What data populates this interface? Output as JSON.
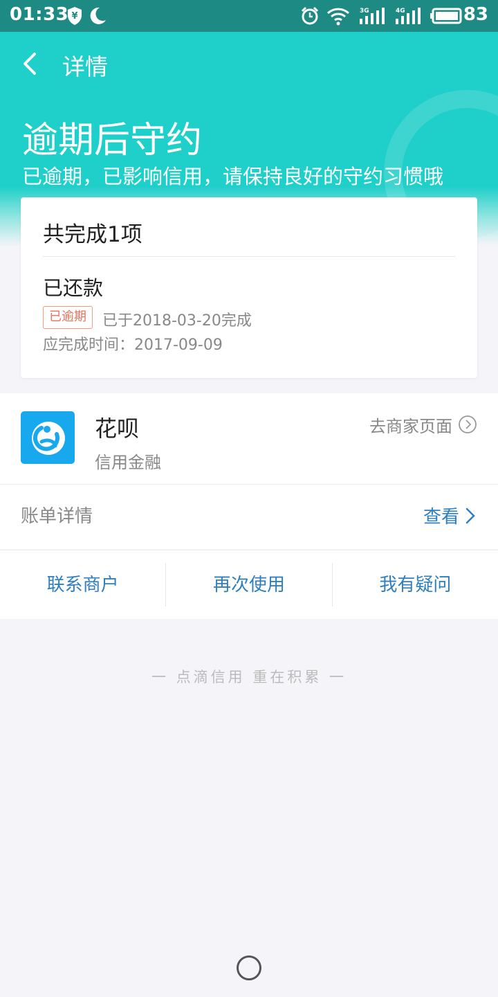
{
  "status_bar": {
    "time": "01:33",
    "battery_pct": "83",
    "network_3g": "3G",
    "network_4g": "4G",
    "icons": [
      "shield-yen-icon",
      "moon-icon",
      "alarm-icon",
      "wifi-icon",
      "signal-3g-icon",
      "signal-4g-icon",
      "battery-icon"
    ]
  },
  "nav": {
    "title": "详情",
    "back_icon": "chevron-left-icon"
  },
  "hero": {
    "title": "逾期后守约",
    "subtitle": "已逾期，已影响信用，请保持良好的守约习惯哦"
  },
  "summary_card": {
    "count_text": "共完成1项",
    "task_title": "已还款",
    "badge": "已逾期",
    "completed_text": "已于2018-03-20完成",
    "deadline_text": "应完成时间：2017-09-09"
  },
  "merchant": {
    "name": "花呗",
    "category": "信用金融",
    "goto_label": "去商家页面",
    "bill_label": "账单详情",
    "bill_view_label": "查看"
  },
  "actions": [
    {
      "label": "联系商户"
    },
    {
      "label": "再次使用"
    },
    {
      "label": "我有疑问"
    }
  ],
  "footer": {
    "slogan": "一 点滴信用 重在积累 一"
  },
  "colors": {
    "status_bar": "#1d8a84",
    "hero": "#1fcfca",
    "accent_link": "#2e7fc1",
    "badge": "#e8735a",
    "logo_blue": "#18a8ee"
  }
}
